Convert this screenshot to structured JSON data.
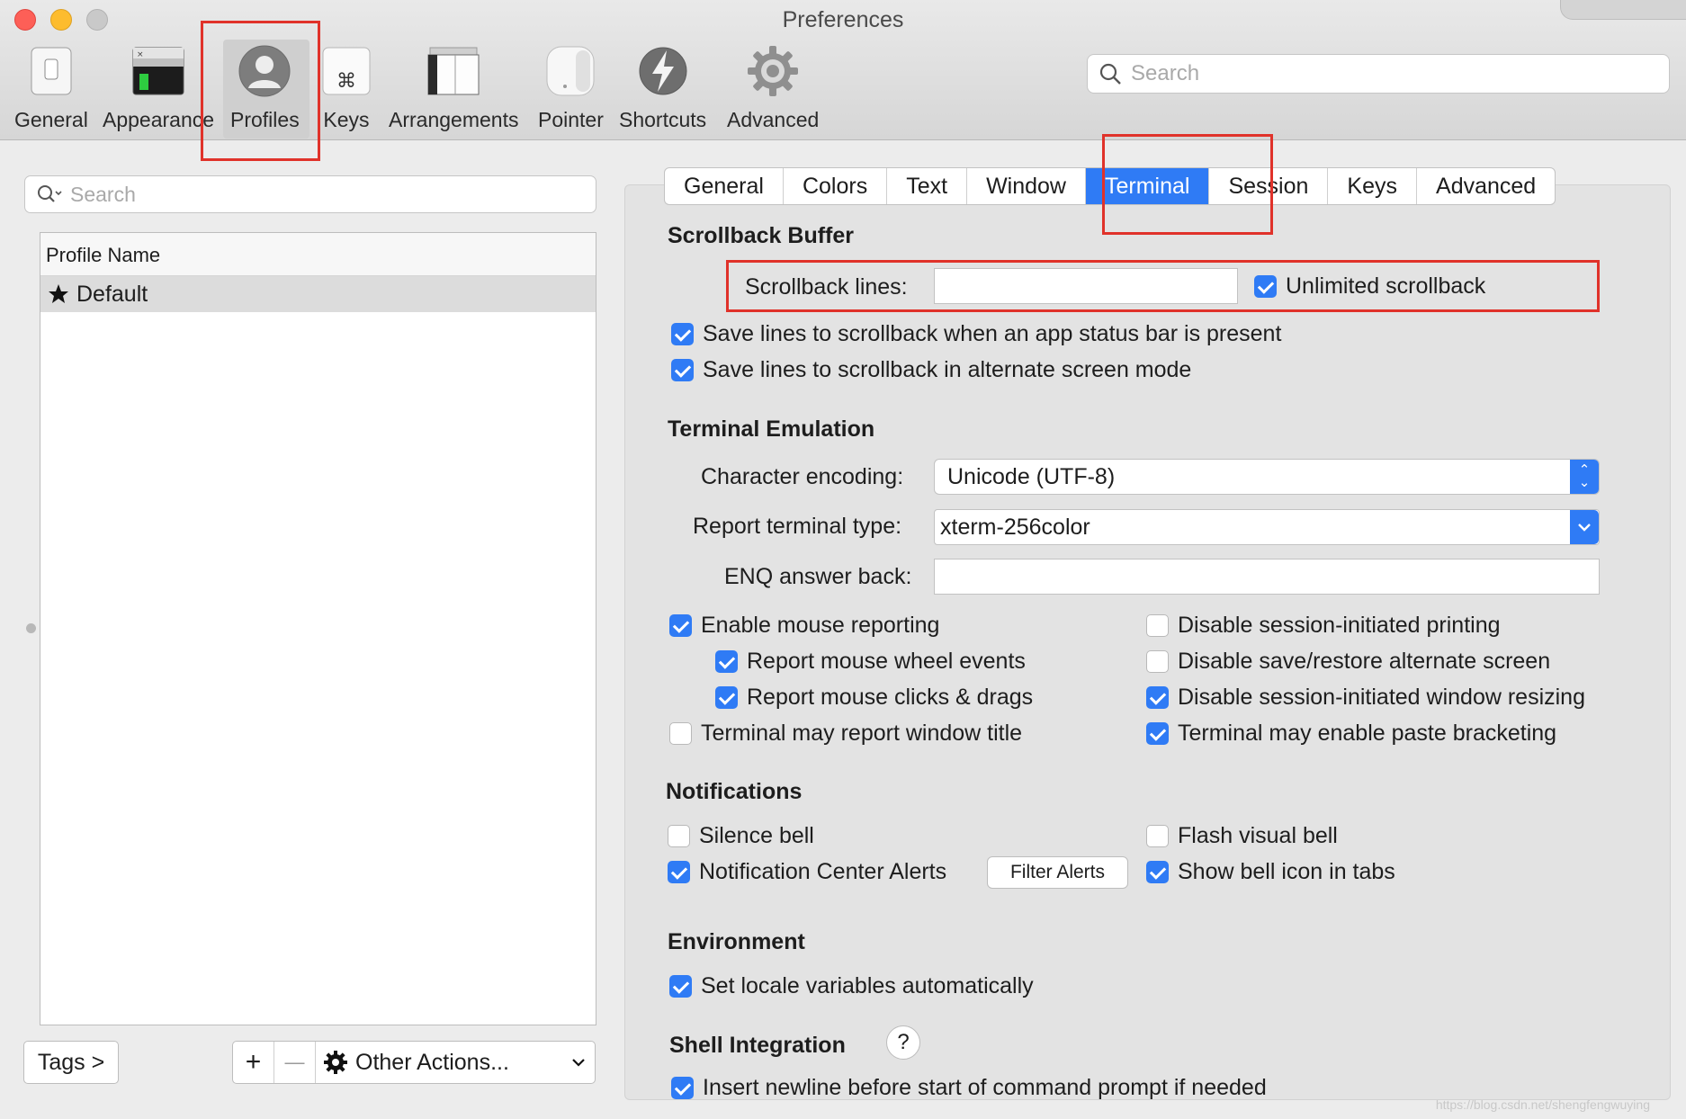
{
  "window": {
    "title": "Preferences"
  },
  "toolbar": {
    "items": [
      {
        "label": "General",
        "icon": "general-switch-icon"
      },
      {
        "label": "Appearance",
        "icon": "appearance-window-icon"
      },
      {
        "label": "Profiles",
        "icon": "profile-person-icon",
        "selected": true
      },
      {
        "label": "Keys",
        "icon": "command-key-icon"
      },
      {
        "label": "Arrangements",
        "icon": "arrangements-icon"
      },
      {
        "label": "Pointer",
        "icon": "mouse-icon"
      },
      {
        "label": "Shortcuts",
        "icon": "lightning-icon"
      },
      {
        "label": "Advanced",
        "icon": "gear-icon"
      }
    ],
    "search_placeholder": "Search"
  },
  "left": {
    "search_placeholder": "Search",
    "list_header": "Profile Name",
    "profiles": [
      {
        "name": "Default",
        "icon": "star-icon",
        "selected": true
      }
    ],
    "tags_label": "Tags >",
    "add_label": "+",
    "remove_label": "—",
    "other_actions_label": "Other Actions..."
  },
  "tabs": [
    "General",
    "Colors",
    "Text",
    "Window",
    "Terminal",
    "Session",
    "Keys",
    "Advanced"
  ],
  "active_tab": "Terminal",
  "scrollback": {
    "title": "Scrollback Buffer",
    "lines_label": "Scrollback lines:",
    "lines_value": "",
    "unlimited_label": "Unlimited scrollback",
    "unlimited_checked": true,
    "opt1_label": "Save lines to scrollback when an app status bar is present",
    "opt1_checked": true,
    "opt2_label": "Save lines to scrollback in alternate screen mode",
    "opt2_checked": true
  },
  "emulation": {
    "title": "Terminal Emulation",
    "encoding_label": "Character encoding:",
    "encoding_value": "Unicode (UTF-8)",
    "termtype_label": "Report terminal type:",
    "termtype_value": "xterm-256color",
    "enq_label": "ENQ answer back:",
    "enq_value": "",
    "left_opts": [
      {
        "label": "Enable mouse reporting",
        "checked": true
      },
      {
        "label": "Report mouse wheel events",
        "checked": true
      },
      {
        "label": "Report mouse clicks & drags",
        "checked": true
      },
      {
        "label": "Terminal may report window title",
        "checked": false
      }
    ],
    "right_opts": [
      {
        "label": "Disable session-initiated printing",
        "checked": false
      },
      {
        "label": "Disable save/restore alternate screen",
        "checked": false
      },
      {
        "label": "Disable session-initiated window resizing",
        "checked": true
      },
      {
        "label": "Terminal may enable paste bracketing",
        "checked": true
      }
    ]
  },
  "notifications": {
    "title": "Notifications",
    "silence_label": "Silence bell",
    "silence_checked": false,
    "ncalerts_label": "Notification Center Alerts",
    "ncalerts_checked": true,
    "filter_label": "Filter Alerts",
    "flash_label": "Flash visual bell",
    "flash_checked": false,
    "bellicon_label": "Show bell icon in tabs",
    "bellicon_checked": true
  },
  "environment": {
    "title": "Environment",
    "locale_label": "Set locale variables automatically",
    "locale_checked": true
  },
  "shell": {
    "title": "Shell Integration",
    "help_label": "?",
    "newline_label": "Insert newline before start of command prompt if needed",
    "newline_checked": true
  },
  "watermark": "https://blog.csdn.net/shengfengwuying",
  "colors": {
    "accent": "#2f7bf5",
    "highlight": "#e0322a"
  }
}
